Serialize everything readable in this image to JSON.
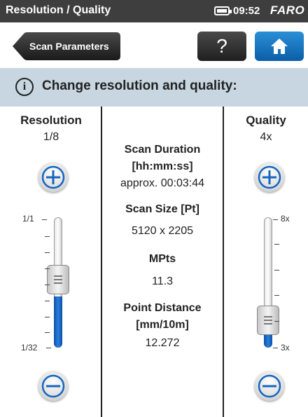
{
  "statusbar": {
    "title": "Resolution / Quality",
    "time": "09:52",
    "brand": "FARO",
    "battery_icon": "battery-icon"
  },
  "nav": {
    "back_label": "Scan Parameters",
    "help_label": "?",
    "home_icon": "home-icon"
  },
  "header": {
    "info_symbol": "i",
    "text": "Change resolution and quality:"
  },
  "resolution": {
    "title": "Resolution",
    "value": "1/8",
    "slider": {
      "top_label": "1/1",
      "bottom_label": "1/32",
      "level_fraction": 0.6
    }
  },
  "quality": {
    "title": "Quality",
    "value": "4x",
    "slider": {
      "top_label": "8x",
      "bottom_label": "3x",
      "level_fraction": 0.2
    }
  },
  "info": {
    "duration_label_1": "Scan Duration",
    "duration_label_2": "[hh:mm:ss]",
    "duration_value": "approx.  00:03:44",
    "size_label": "Scan Size [Pt]",
    "size_value": "5120  x  2205",
    "mpts_label": "MPts",
    "mpts_value": "11.3",
    "distance_label_1": "Point Distance",
    "distance_label_2": "[mm/10m]",
    "distance_value": "12.272"
  },
  "colors": {
    "accent_blue": "#1565c0",
    "header_bg": "#c7d6e0",
    "statusbar_bg": "#3e3e3e"
  }
}
